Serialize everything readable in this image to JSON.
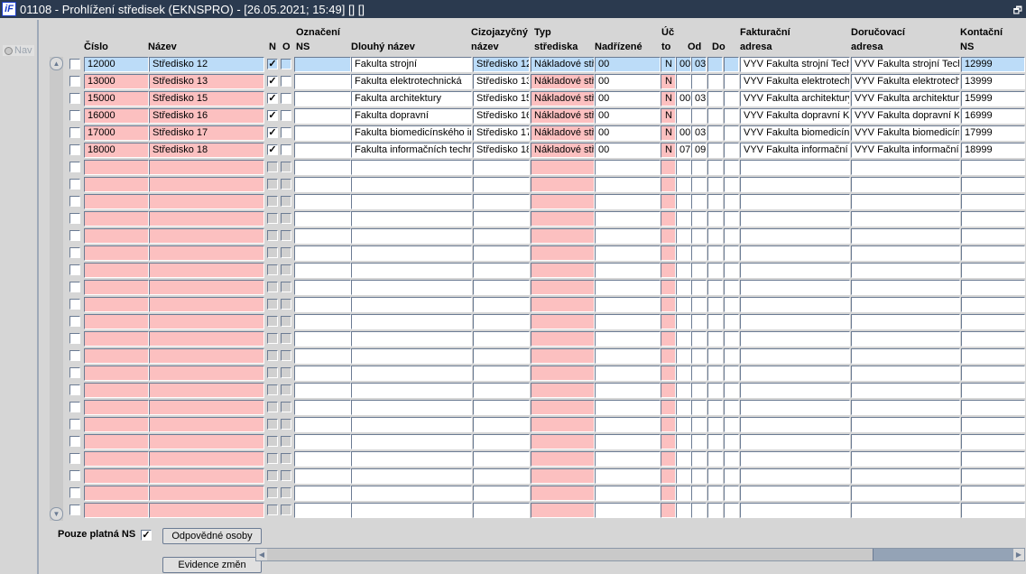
{
  "window": {
    "title": "01108 - Prohlížení středisek (EKNSPRO) - [26.05.2021; 15:49]  [] []",
    "logo": "iF"
  },
  "nav": {
    "label": "Nav"
  },
  "headers": {
    "cislo": "Číslo",
    "nazev": "Název",
    "n": "N",
    "o": "O",
    "oznaceni1": "Označení",
    "oznaceni2": "NS",
    "dlouhy": "Dlouhý název",
    "cizo1": "Cizojazyčný",
    "cizo2": "název",
    "typ1": "Typ",
    "typ2": "střediska",
    "nadrizene": "Nadřízené",
    "ucto1": "Úč",
    "ucto2": "to",
    "od": "Od",
    "do": "Do",
    "fakt1": "Fakturační",
    "fakt2": "adresa",
    "doruc1": "Doručovací",
    "doruc2": "adresa",
    "kont1": "Kontační",
    "kont2": "NS"
  },
  "rows": [
    {
      "cislo": "12000",
      "nazev": "Středisko 12",
      "n": true,
      "o": false,
      "oznaceni": "",
      "dlouhy": "Fakulta strojní",
      "cizo": "Středisko 12",
      "typ": "Nákladové stř",
      "nadrizene": "00",
      "ucto": "N",
      "od1": "00",
      "od2": "03",
      "do1": "",
      "do2": "",
      "fakt": "VYV Fakulta strojní Tech",
      "doruc": "VYV Fakulta strojní Tech",
      "kont": "12999"
    },
    {
      "cislo": "13000",
      "nazev": "Středisko 13",
      "n": true,
      "o": false,
      "oznaceni": "",
      "dlouhy": "Fakulta elektrotechnická",
      "cizo": "Středisko 13",
      "typ": "Nákladové stř",
      "nadrizene": "00",
      "ucto": "N",
      "od1": "",
      "od2": "",
      "do1": "",
      "do2": "",
      "fakt": "VYV Fakulta elektrotech",
      "doruc": "VYV Fakulta elektrotech",
      "kont": "13999"
    },
    {
      "cislo": "15000",
      "nazev": "Středisko 15",
      "n": true,
      "o": false,
      "oznaceni": "",
      "dlouhy": "Fakulta architektury",
      "cizo": "Středisko 15",
      "typ": "Nákladové stř",
      "nadrizene": "00",
      "ucto": "N",
      "od1": "00",
      "od2": "03",
      "do1": "",
      "do2": "",
      "fakt": "VYV Fakulta architektury",
      "doruc": "VYV Fakulta architektury",
      "kont": "15999"
    },
    {
      "cislo": "16000",
      "nazev": "Středisko 16",
      "n": true,
      "o": false,
      "oznaceni": "",
      "dlouhy": "Fakulta dopravní",
      "cizo": "Středisko 16",
      "typ": "Nákladové stř",
      "nadrizene": "00",
      "ucto": "N",
      "od1": "",
      "od2": "",
      "do1": "",
      "do2": "",
      "fakt": "VYV Fakulta dopravní K",
      "doruc": "VYV Fakulta dopravní K",
      "kont": "16999"
    },
    {
      "cislo": "17000",
      "nazev": "Středisko 17",
      "n": true,
      "o": false,
      "oznaceni": "",
      "dlouhy": "Fakulta biomedicínského inž",
      "cizo": "Středisko 17",
      "typ": "Nákladové stř",
      "nadrizene": "00",
      "ucto": "N",
      "od1": "00",
      "od2": "03",
      "do1": "",
      "do2": "",
      "fakt": "VYV Fakulta biomedicíns",
      "doruc": "VYV Fakulta biomedicíns",
      "kont": "17999"
    },
    {
      "cislo": "18000",
      "nazev": "Středisko 18",
      "n": true,
      "o": false,
      "oznaceni": "",
      "dlouhy": "Fakulta informačních techn",
      "cizo": "Středisko 18",
      "typ": "Nákladové stř",
      "nadrizene": "00",
      "ucto": "N",
      "od1": "07",
      "od2": "09",
      "do1": "",
      "do2": "",
      "fakt": "VYV Fakulta informační",
      "doruc": "VYV Fakulta informační",
      "kont": "18999"
    }
  ],
  "empty_rows": 21,
  "footer": {
    "pouze_label": "Pouze platná NS",
    "pouze_checked": true,
    "btn_osoby": "Odpovědné osoby",
    "btn_evidence": "Evidence změn"
  },
  "colors": {
    "title_bg": "#2b3a4f",
    "required": "#fcc0c0",
    "selected": "#bcdcf8"
  }
}
